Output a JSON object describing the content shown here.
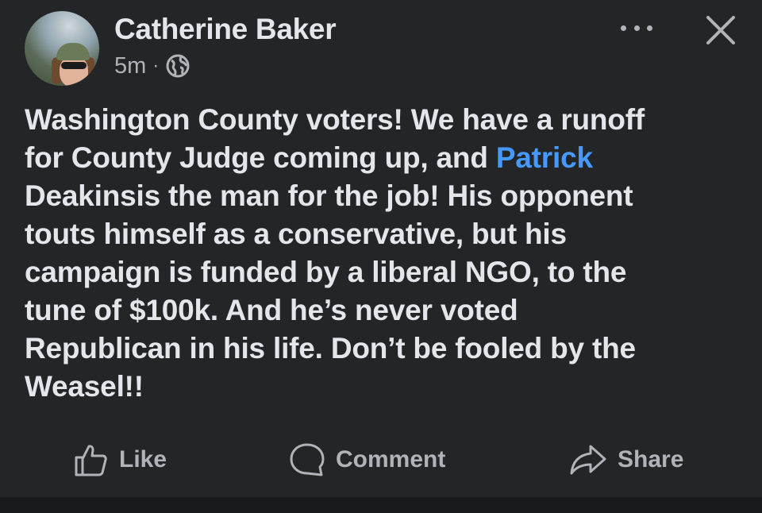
{
  "post": {
    "author_name": "Catherine Baker",
    "timestamp": "5m",
    "separator": "·",
    "privacy_icon": "globe-icon",
    "body_before_mention": "Washington County voters! We have a runoff\nfor County Judge coming up, and ",
    "mention": "Patrick",
    "body_after_mention": "\nDeakinsis the man for the job! His opponent\ntouts himself as a conservative, but his\ncampaign is funded by a liberal NGO, to the\ntune of $100k. And he’s never voted\nRepublican in his life. Don’t be fooled by the\nWeasel!!"
  },
  "header": {
    "more_icon": "more-options-icon",
    "close_icon": "close-icon"
  },
  "actions": {
    "like_label": "Like",
    "comment_label": "Comment",
    "share_label": "Share"
  },
  "colors": {
    "background": "#242526",
    "text_primary": "#e4e6eb",
    "text_secondary": "#b0b3b8",
    "mention": "#4599ff"
  }
}
